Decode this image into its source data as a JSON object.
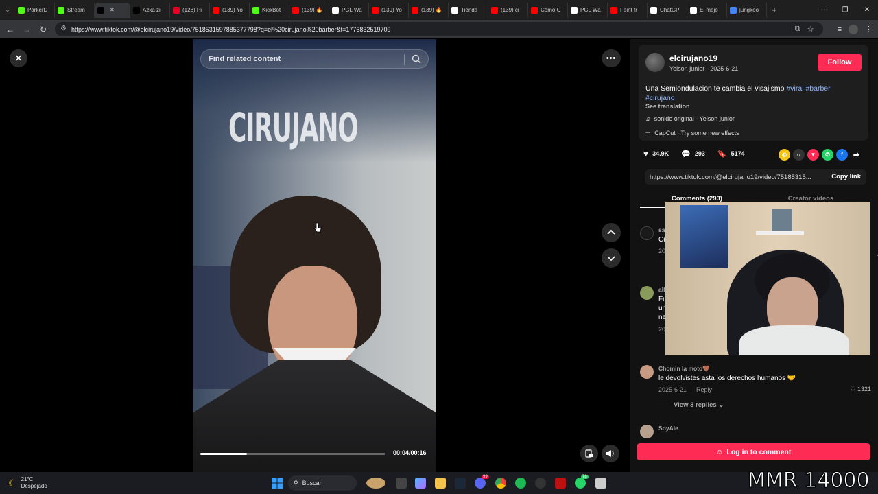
{
  "browser": {
    "tabs": [
      {
        "label": "ParkerD",
        "color": "#53fc18"
      },
      {
        "label": "Stream",
        "color": "#53fc18"
      },
      {
        "label": "",
        "color": "#000000",
        "active": true
      },
      {
        "label": "Azka zi",
        "color": "#000000"
      },
      {
        "label": "(128) Pi",
        "color": "#e60023"
      },
      {
        "label": "(139) Yo",
        "color": "#ff0000"
      },
      {
        "label": "KickBot",
        "color": "#53fc18"
      },
      {
        "label": "(139) 🔥",
        "color": "#ff0000"
      },
      {
        "label": "PGL Wa",
        "color": "#ffffff"
      },
      {
        "label": "(139) Yo",
        "color": "#ff0000"
      },
      {
        "label": "(139) 🔥",
        "color": "#ff0000"
      },
      {
        "label": "Tienda",
        "color": "#ffffff"
      },
      {
        "label": "(139) ci",
        "color": "#ff0000"
      },
      {
        "label": "Cómo C",
        "color": "#ff0000"
      },
      {
        "label": "PGL Wa",
        "color": "#ffffff"
      },
      {
        "label": "Feint fr",
        "color": "#ff0000"
      },
      {
        "label": "ChatGP",
        "color": "#ffffff"
      },
      {
        "label": "El mejo",
        "color": "#ffffff"
      },
      {
        "label": "jungkoo",
        "color": "#4285f4"
      }
    ],
    "url": "https://www.tiktok.com/@elcirujano19/video/7518531597885377798?q=el%20cirujano%20barber&t=1776832519709"
  },
  "video": {
    "search_placeholder": "Find related content",
    "sign_text": "CIRUJANO",
    "progress": 0.25,
    "timecode": "00:04/00:16"
  },
  "post": {
    "username": "elcirujano19",
    "sub": "Yeison junior · 2025-6-21",
    "follow_label": "Follow",
    "desc_text": "Una Semiondulacion te cambia el visajismo ",
    "tags": [
      "#viral",
      "#barber",
      "#cirujano"
    ],
    "see_translation": "See translation",
    "music": "sonido original - Yeison junior",
    "capcut": "CapCut · Try some new effects",
    "likes": "34.9K",
    "comments": "293",
    "saves": "5174",
    "link": "https://www.tiktok.com/@elcirujano19/video/75185315...",
    "copy_link": "Copy link",
    "tab_comments": "Comments (293)",
    "tab_creator": "Creator videos"
  },
  "comments": [
    {
      "name": "sa",
      "text": "Cu",
      "date": "20",
      "reply": "",
      "likes": "4"
    },
    {
      "name": "all",
      "text": "Fu",
      "date": "20",
      "reply": "",
      "likes": ""
    },
    {
      "name": "Chomin la moto🤎",
      "text": "le devolvistes asta los derechos humanos 🤝",
      "date": "2025-6-21",
      "reply": "Reply",
      "likes": "1321",
      "replies": "View 3 replies"
    },
    {
      "name": "SoyAle",
      "text": "",
      "date": "",
      "reply": "",
      "likes": ""
    }
  ],
  "partial_lines": [
    "un",
    "na"
  ],
  "login_label": "Log in to comment",
  "taskbar": {
    "temp": "21°C",
    "weather": "Despejado",
    "search": "Buscar",
    "badge1": "99",
    "badge2": "78"
  },
  "overlay": {
    "mmr": "MMR 14000"
  }
}
